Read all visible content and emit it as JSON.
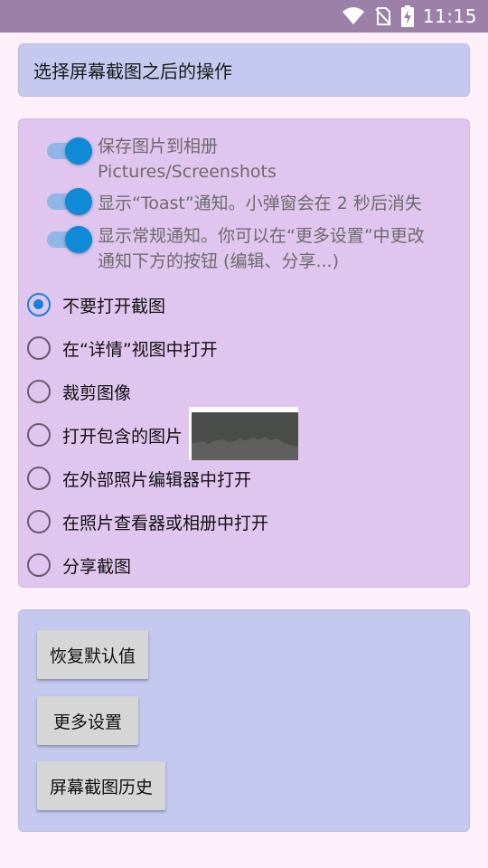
{
  "status_bar": {
    "time": "11:15",
    "icons": [
      "wifi-icon",
      "no-sim-icon",
      "battery-charging-icon"
    ]
  },
  "header": {
    "title": "选择屏幕截图之后的操作"
  },
  "toggles": [
    {
      "line1": "保存图片到相册",
      "line2": "Pictures/Screenshots",
      "on": true
    },
    {
      "line1": "显示“Toast”通知。小弹窗会在 2 秒后消失",
      "line2": "",
      "on": true
    },
    {
      "line1": "显示常规通知。你可以在“更多设置”中更改",
      "line2": "通知下方的按钮 (编辑、分享...)",
      "on": true
    }
  ],
  "radio_options": [
    {
      "label": "不要打开截图",
      "selected": true
    },
    {
      "label": "在“详情”视图中打开",
      "selected": false
    },
    {
      "label": "裁剪图像",
      "selected": false
    },
    {
      "label": "打开包含的图片",
      "selected": false
    },
    {
      "label": "在外部照片编辑器中打开",
      "selected": false
    },
    {
      "label": "在照片查看器或相册中打开",
      "selected": false
    },
    {
      "label": "分享截图",
      "selected": false
    }
  ],
  "buttons": {
    "restore_defaults": "恢复默认值",
    "more_settings": "更多设置",
    "history": "屏幕截图历史"
  },
  "colors": {
    "status_bar": "#9c80a8",
    "accent": "#0e8ad6",
    "options_card": "#e0c5ef",
    "title_card": "#c5c9ef"
  }
}
